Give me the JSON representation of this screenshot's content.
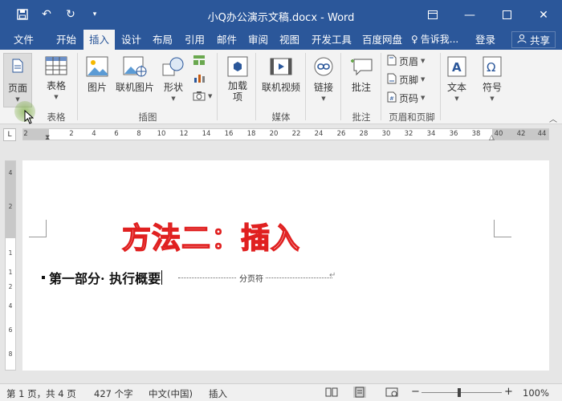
{
  "window": {
    "title": "小Q办公演示文稿.docx - Word",
    "qat": {
      "save_icon": "save-icon",
      "undo_icon": "undo-icon",
      "redo_icon": "redo-icon",
      "customize_icon": "customize-icon"
    }
  },
  "tabs": {
    "items": [
      "文件",
      "开始",
      "插入",
      "设计",
      "布局",
      "引用",
      "邮件",
      "审阅",
      "视图",
      "开发工具",
      "百度网盘"
    ],
    "active": "插入",
    "tell_me": "告诉我...",
    "login": "登录",
    "share": "共享"
  },
  "ribbon": {
    "pages": {
      "label": "页面",
      "group": ""
    },
    "table": {
      "label": "表格",
      "group": "表格"
    },
    "illustrations": {
      "group": "插图",
      "picture": "图片",
      "online_picture": "联机图片",
      "shapes": "形状"
    },
    "addins": {
      "label1": "加载",
      "label2": "项 "
    },
    "media": {
      "label": "联机视频",
      "group": "媒体"
    },
    "links": {
      "label": "链接"
    },
    "comments": {
      "label": "批注",
      "group": "批注"
    },
    "header_footer": {
      "header": "页眉",
      "footer": "页脚",
      "page_number": "页码",
      "group": "页眉和页脚"
    },
    "text": {
      "label": "文本"
    },
    "symbols": {
      "label": "符号"
    }
  },
  "ruler": {
    "corner": "L",
    "ticks": [
      "2",
      "2",
      "4",
      "6",
      "8",
      "10",
      "12",
      "14",
      "16",
      "18",
      "20",
      "22",
      "24",
      "26",
      "28",
      "30",
      "32",
      "34",
      "36",
      "38",
      "40",
      "42",
      "44"
    ],
    "vticks": [
      "4",
      "2",
      "1",
      "1",
      "2",
      "4",
      "6",
      "8"
    ]
  },
  "document": {
    "watermark_title": "方法二：插入",
    "heading": "第一部分· 执行概要",
    "page_break_label": "分页符",
    "pilcrow": "↵"
  },
  "statusbar": {
    "page": "第 1 页，共 4 页",
    "words": "427 个字",
    "language": "中文(中国)",
    "mode": "插入",
    "zoom": "100%",
    "zoom_minus": "−",
    "zoom_plus": "+"
  },
  "colors": {
    "accent": "#2b579a",
    "watermark_outline": "#e02020"
  }
}
